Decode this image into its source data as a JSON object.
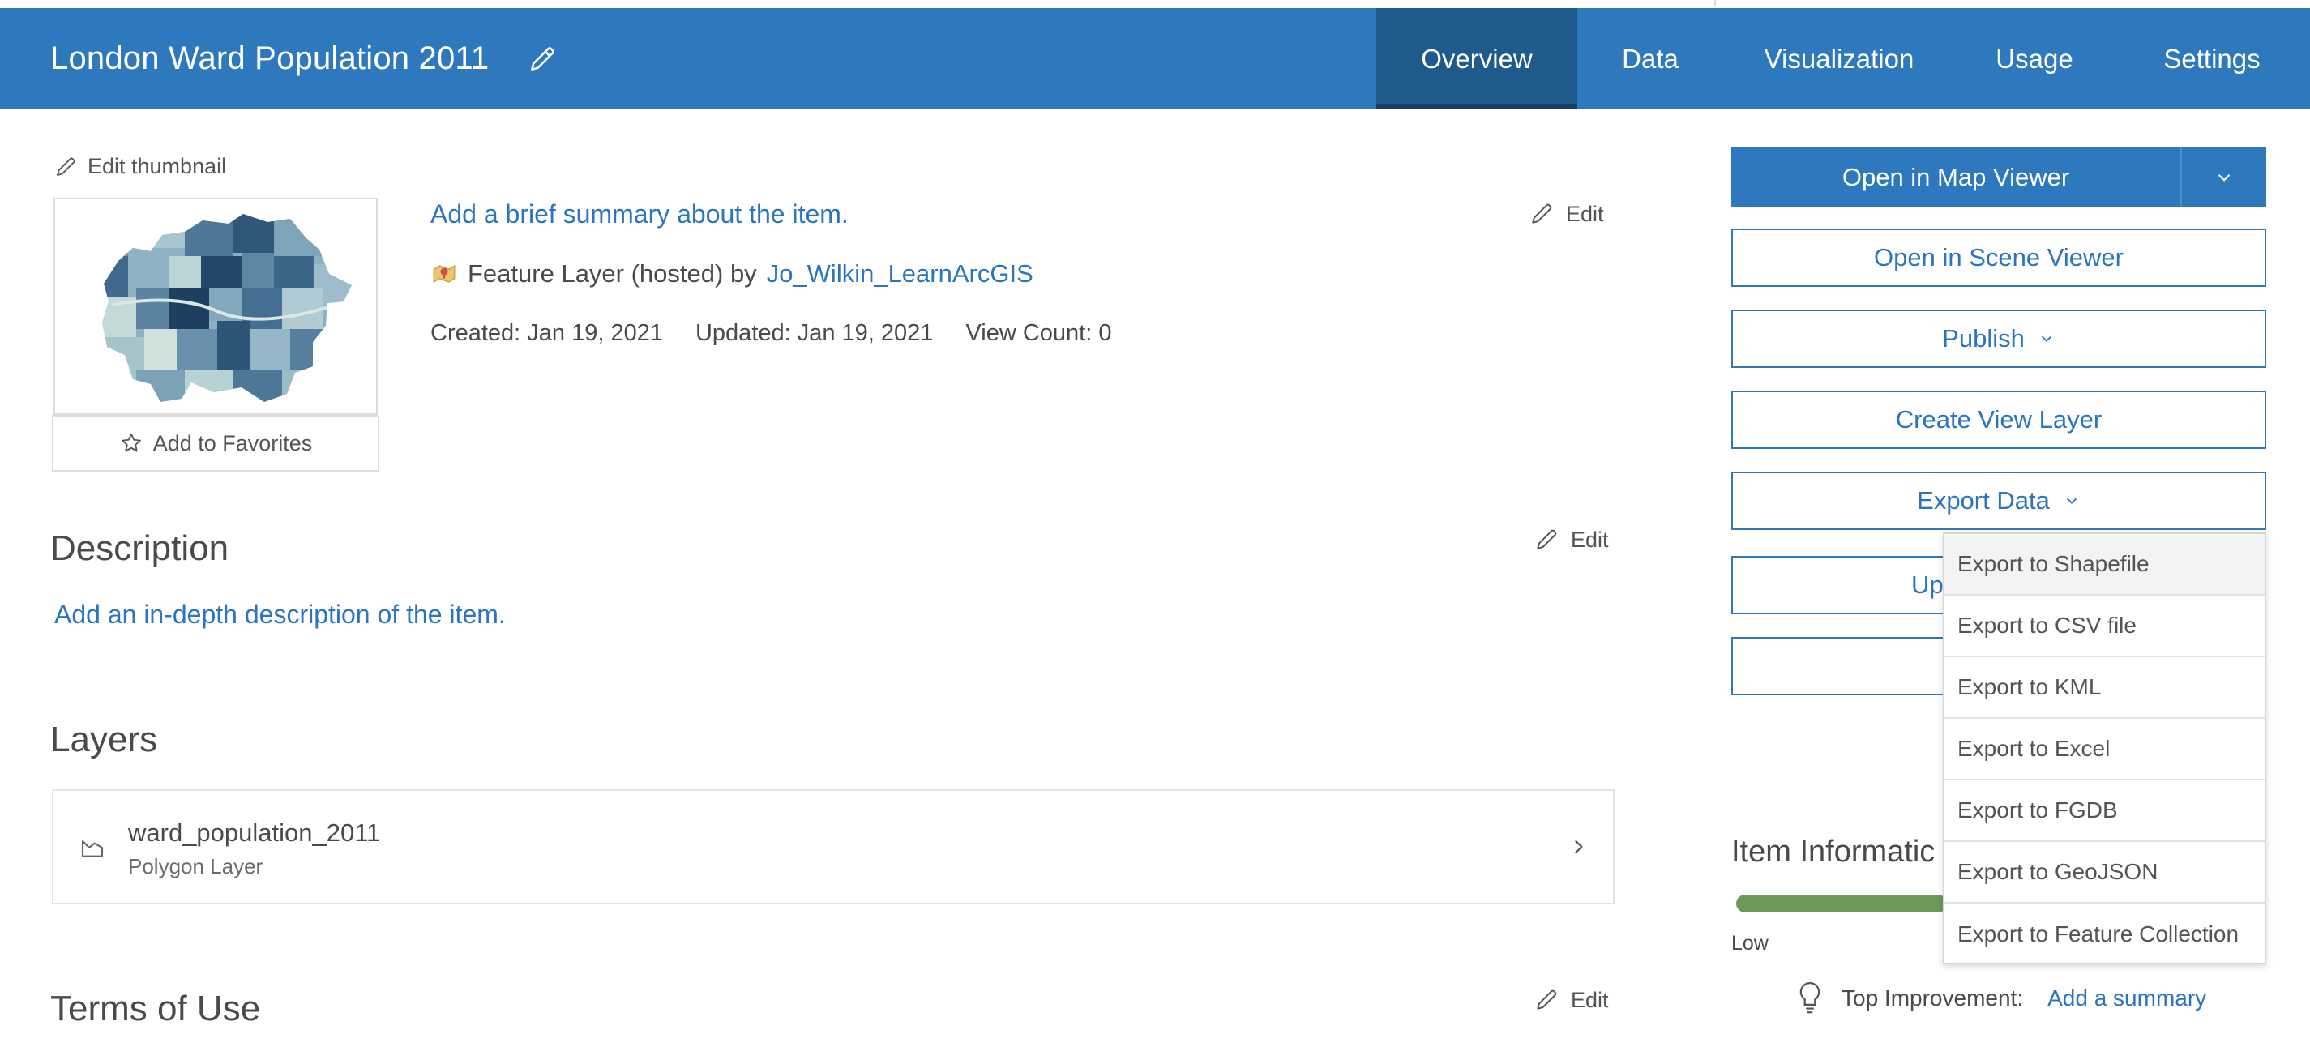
{
  "header": {
    "title": "London Ward Population 2011",
    "tabs": [
      {
        "label": "Overview",
        "active": true
      },
      {
        "label": "Data"
      },
      {
        "label": "Visualization"
      },
      {
        "label": "Usage"
      },
      {
        "label": "Settings"
      }
    ]
  },
  "thumbnail": {
    "edit_label": "Edit thumbnail",
    "favorites_label": "Add to Favorites"
  },
  "summary": {
    "placeholder": "Add a brief summary about the item.",
    "edit_label": "Edit",
    "type_text": "Feature Layer (hosted) by",
    "owner": "Jo_Wilkin_LearnArcGIS",
    "created": "Created: Jan 19, 2021",
    "updated": "Updated: Jan 19, 2021",
    "view_count": "View Count: 0"
  },
  "description": {
    "title": "Description",
    "edit_label": "Edit",
    "placeholder": "Add an in-depth description of the item."
  },
  "layers": {
    "title": "Layers",
    "items": [
      {
        "name": "ward_population_2011",
        "type": "Polygon Layer"
      }
    ]
  },
  "terms": {
    "title": "Terms of Use",
    "edit_label": "Edit"
  },
  "actions": {
    "open_map_viewer": "Open in Map Viewer",
    "open_scene_viewer": "Open in Scene Viewer",
    "publish": "Publish",
    "create_view_layer": "Create View Layer",
    "export_data": "Export Data",
    "update_partial": "Up"
  },
  "export_menu": {
    "items": [
      "Export to Shapefile",
      "Export to CSV file",
      "Export to KML",
      "Export to Excel",
      "Export to FGDB",
      "Export to GeoJSON",
      "Export to Feature Collection"
    ],
    "hovered_index": 0
  },
  "item_information": {
    "title": "Item Informatic",
    "score_label": "Low",
    "top_improvement_label": "Top Improvement:",
    "top_improvement_link": "Add a summary"
  },
  "colors": {
    "header_blue": "#2e78bd",
    "active_tab": "#1f5a8c",
    "link_blue": "#2b74be",
    "score_green": "#6b9a57"
  },
  "icons": {
    "title_edit": "pencil-icon",
    "layer_type": "polygon-layer-icon",
    "favorite": "star-outline-icon",
    "item_type": "feature-layer-icon",
    "improvement": "lightbulb-icon"
  }
}
